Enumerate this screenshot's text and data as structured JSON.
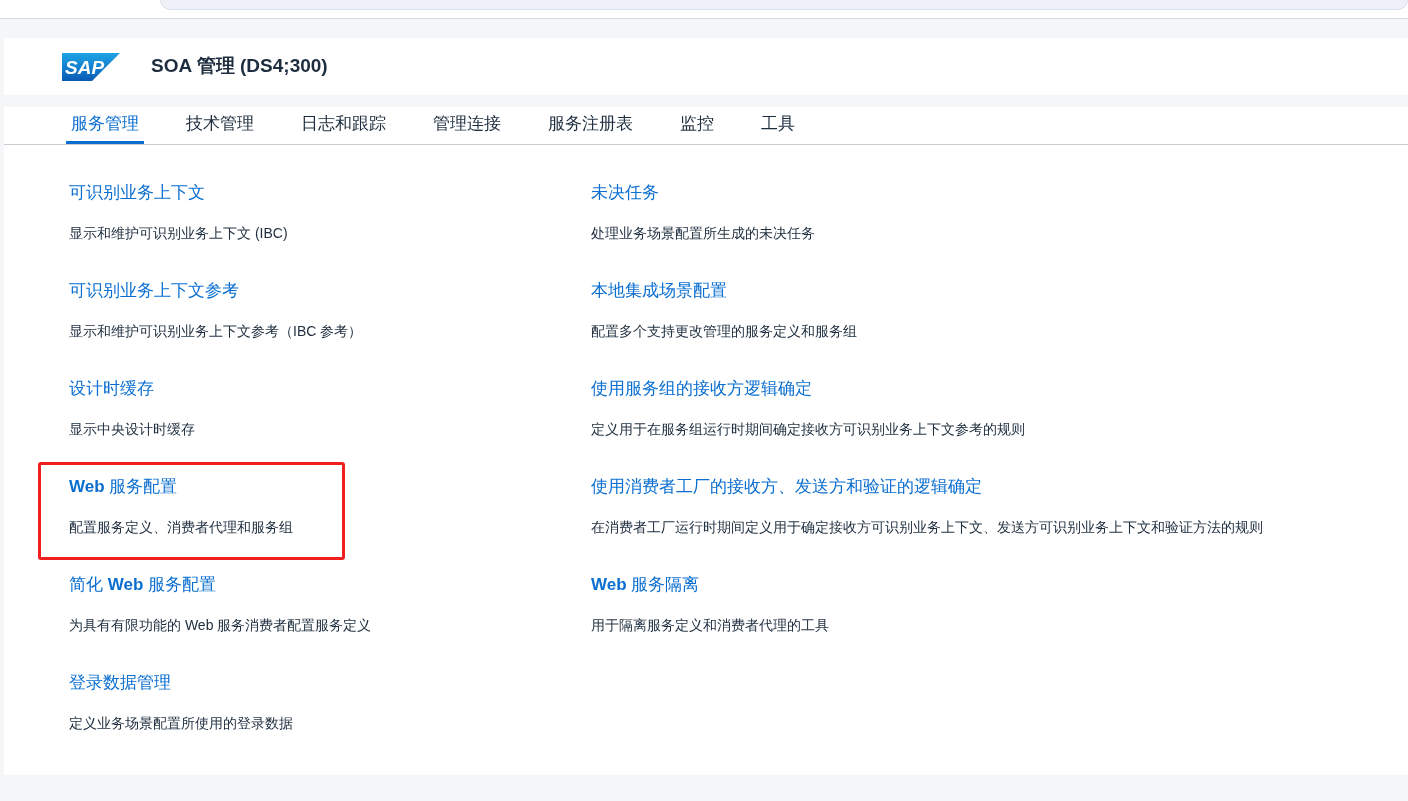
{
  "header": {
    "logo": "SAP",
    "title": "SOA 管理 (DS4;300)"
  },
  "tabs": [
    {
      "label": "服务管理",
      "selected": true
    },
    {
      "label": "技术管理",
      "selected": false
    },
    {
      "label": "日志和跟踪",
      "selected": false
    },
    {
      "label": "管理连接",
      "selected": false
    },
    {
      "label": "服务注册表",
      "selected": false
    },
    {
      "label": "监控",
      "selected": false
    },
    {
      "label": "工具",
      "selected": false
    }
  ],
  "columns": [
    {
      "items": [
        {
          "title": "可识别业务上下文",
          "description": "显示和维护可识别业务上下文 (IBC)",
          "highlighted": false
        },
        {
          "title": "可识别业务上下文参考",
          "description": "显示和维护可识别业务上下文参考（IBC 参考）",
          "highlighted": false
        },
        {
          "title": "设计时缓存",
          "description": "显示中央设计时缓存",
          "highlighted": false
        },
        {
          "title": "**Web** 服务配置",
          "description": "配置服务定义、消费者代理和服务组",
          "highlighted": true
        },
        {
          "title": "简化 **Web** 服务配置",
          "description": "为具有有限功能的 Web 服务消费者配置服务定义",
          "highlighted": false
        },
        {
          "title": "登录数据管理",
          "description": "定义业务场景配置所使用的登录数据",
          "highlighted": false
        }
      ]
    },
    {
      "items": [
        {
          "title": "未决任务",
          "description": "处理业务场景配置所生成的未决任务",
          "highlighted": false
        },
        {
          "title": "本地集成场景配置",
          "description": "配置多个支持更改管理的服务定义和服务组",
          "highlighted": false
        },
        {
          "title": "使用服务组的接收方逻辑确定",
          "description": "定义用于在服务组运行时期间确定接收方可识别业务上下文参考的规则",
          "highlighted": false
        },
        {
          "title": "使用消费者工厂的接收方、发送方和验证的逻辑确定",
          "description": "在消费者工厂运行时期间定义用于确定接收方可识别业务上下文、发送方可识别业务上下文和验证方法的规则",
          "highlighted": false
        },
        {
          "title": "**Web** 服务隔离",
          "description": "用于隔离服务定义和消费者代理的工具",
          "highlighted": false
        }
      ]
    }
  ]
}
